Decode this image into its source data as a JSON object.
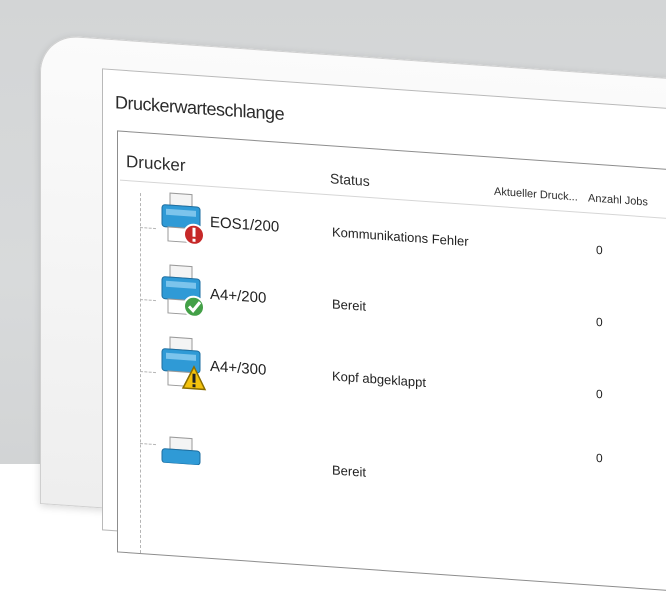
{
  "window": {
    "title": "Druckerwarteschlange"
  },
  "columns": {
    "printer": "Drucker",
    "status": "Status",
    "current": "Aktueller Druck...",
    "jobs": "Anzahl Jobs"
  },
  "rows": [
    {
      "name": "EOS1/200",
      "status": "Kommunikations Fehler",
      "current": "",
      "jobs": "0",
      "badge": "error-icon",
      "badge_color": "#c62828"
    },
    {
      "name": "A4+/200",
      "status": "Bereit",
      "current": "",
      "jobs": "0",
      "badge": "check-icon",
      "badge_color": "#43a047"
    },
    {
      "name": "A4+/300",
      "status": "Kopf abgeklappt",
      "current": "",
      "jobs": "0",
      "badge": "warning-icon",
      "badge_color": "#f4c20d"
    },
    {
      "name": "",
      "status": "Bereit",
      "current": "",
      "jobs": "0",
      "badge": "",
      "badge_color": ""
    }
  ]
}
